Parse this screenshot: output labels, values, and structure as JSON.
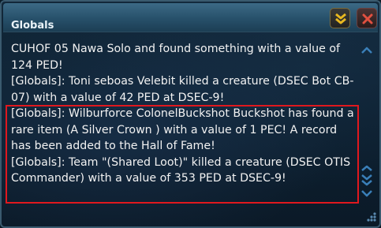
{
  "window": {
    "title": "Globals"
  },
  "chat": {
    "lines": [
      "CUHOF 05 Nawa Solo and found something with a value of 124 PED!",
      "[Globals]: Toni seboas Velebit killed a creature (DSEC Bot CB-07) with a value of 42 PED at DSEC-9!",
      "[Globals]: Wilburforce ColonelBuckshot Buckshot has found a rare item (A Silver Crown ) with a value of 1 PEC! A record has been added to the Hall of Fame!",
      "[Globals]: Team \"(Shared Loot)\" killed a creature (DSEC OTIS Commander) with a value of 353 PED at DSEC-9!"
    ]
  },
  "colors": {
    "text": "#f2f2f2",
    "highlight_border": "#e0181e",
    "title_bar": "#2e5a74",
    "accent_gold": "#e8b820",
    "close_red": "#e05040",
    "scroll_arrows": "#3a7fb8"
  },
  "icons": {
    "collapse": "chevrons-down-icon",
    "close": "close-icon",
    "scroll_up": "chevron-up-icon",
    "scroll_stack": "double-chevron-icon",
    "scroll_down": "chevron-down-icon",
    "resize": "resize-grip-icon"
  }
}
